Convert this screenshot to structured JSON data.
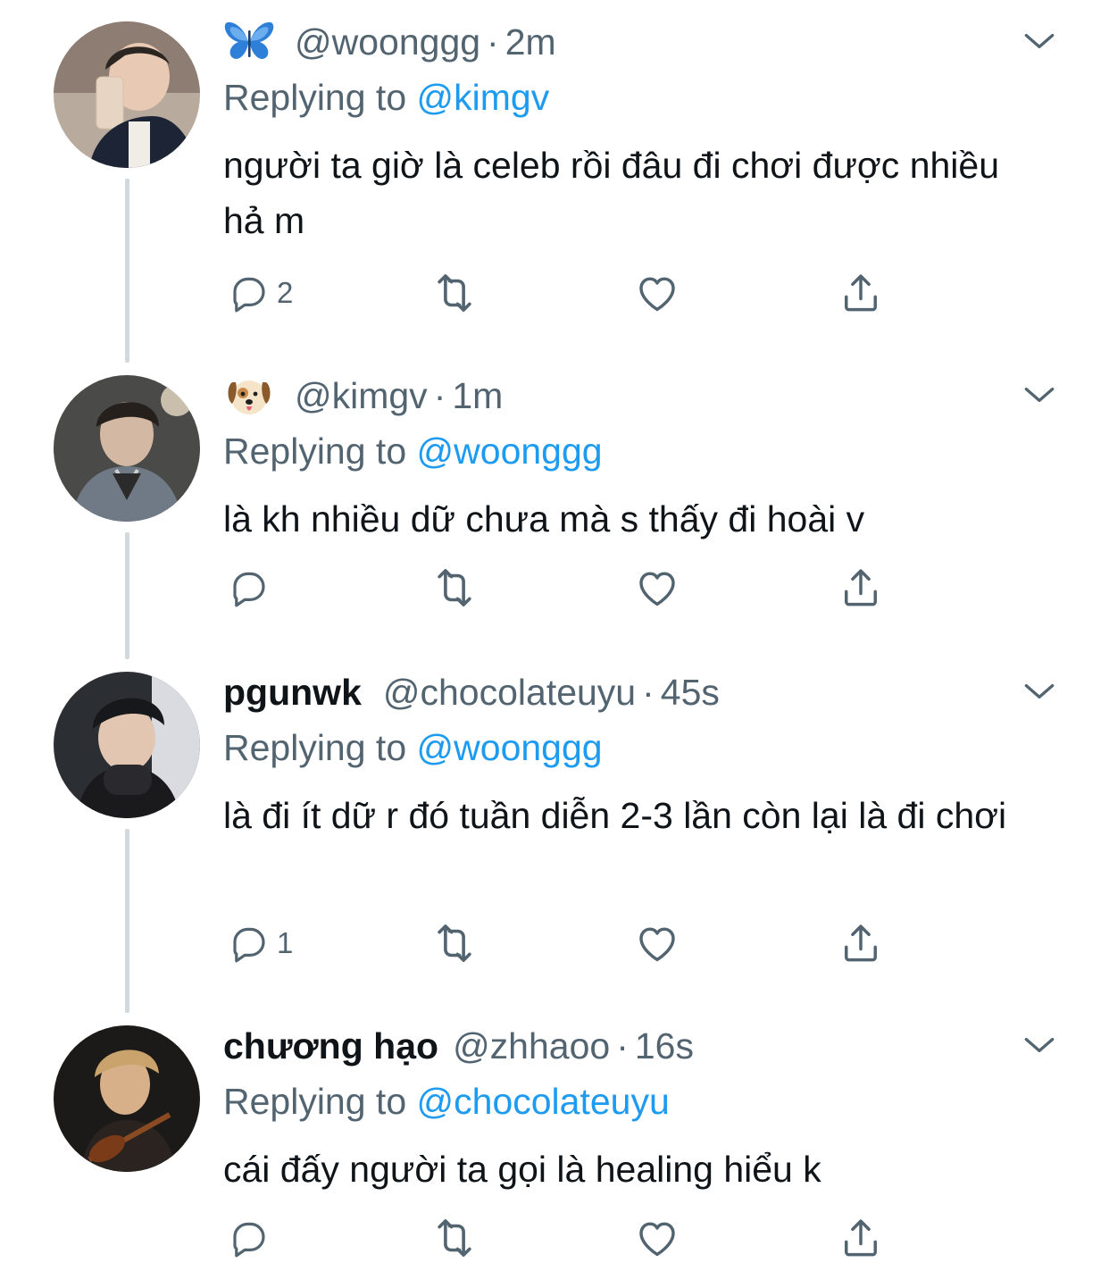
{
  "tweets": [
    {
      "display_name": "",
      "handle": "@woonggg",
      "separator": "·",
      "time": "2m",
      "emoji_icon": "blue-butterfly-icon",
      "replying_label": "Replying to",
      "replying_to": "@kimgv",
      "text": "người ta giờ là celeb rồi đâu đi chơi được nhiều hả m",
      "reply_count": "2"
    },
    {
      "display_name": "",
      "handle": "@kimgv",
      "separator": "·",
      "time": "1m",
      "emoji_icon": "dog-face-icon",
      "replying_label": "Replying to",
      "replying_to": "@woonggg",
      "text": "là kh nhiều dữ chưa mà s thấy đi hoài v",
      "reply_count": ""
    },
    {
      "display_name": "pgunwk",
      "handle": "@chocolateuyu",
      "separator": "·",
      "time": "45s",
      "replying_label": "Replying to",
      "replying_to": "@woonggg",
      "text": "là đi ít dữ r đó tuần diễn 2-3 lần còn lại là đi chơi",
      "reply_count": "1"
    },
    {
      "display_name": "chương hạo",
      "handle": "@zhhaoo",
      "separator": "·",
      "time": "16s",
      "replying_label": "Replying to",
      "replying_to": "@chocolateuyu",
      "text": "cái đấy người ta gọi là healing hiểu k",
      "reply_count": ""
    }
  ],
  "colors": {
    "accent": "#1d9bf0",
    "secondary_text": "#536471",
    "thread_line": "#cfd9de"
  }
}
